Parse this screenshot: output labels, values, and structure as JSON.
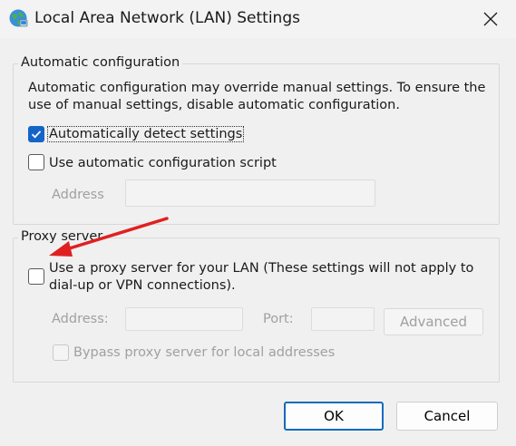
{
  "window": {
    "title": "Local Area Network (LAN) Settings",
    "icon": "network-globe-icon"
  },
  "automatic_configuration": {
    "legend": "Automatic configuration",
    "description_line1": "Automatic configuration may override manual settings.  To ensure the",
    "description_line2": "use of manual settings, disable automatic configuration.",
    "auto_detect": {
      "label": "Automatically detect settings",
      "checked": true
    },
    "auto_script": {
      "label": "Use automatic configuration script",
      "checked": false
    },
    "address": {
      "label": "Address",
      "value": "",
      "enabled": false
    }
  },
  "proxy_server": {
    "legend": "Proxy server",
    "use_proxy": {
      "label_line1": "Use a proxy server for your LAN (These settings will not apply to",
      "label_line2": "dial-up or VPN connections).",
      "checked": false
    },
    "address": {
      "label": "Address:",
      "value": "",
      "enabled": false
    },
    "port": {
      "label": "Port:",
      "value": "",
      "enabled": false
    },
    "advanced_label": "Advanced",
    "bypass": {
      "label": "Bypass proxy server for local addresses",
      "checked": false,
      "enabled": false
    }
  },
  "buttons": {
    "ok": "OK",
    "cancel": "Cancel"
  },
  "colors": {
    "checkbox_accent": "#1464c8",
    "annotation_arrow": "#e02020"
  }
}
